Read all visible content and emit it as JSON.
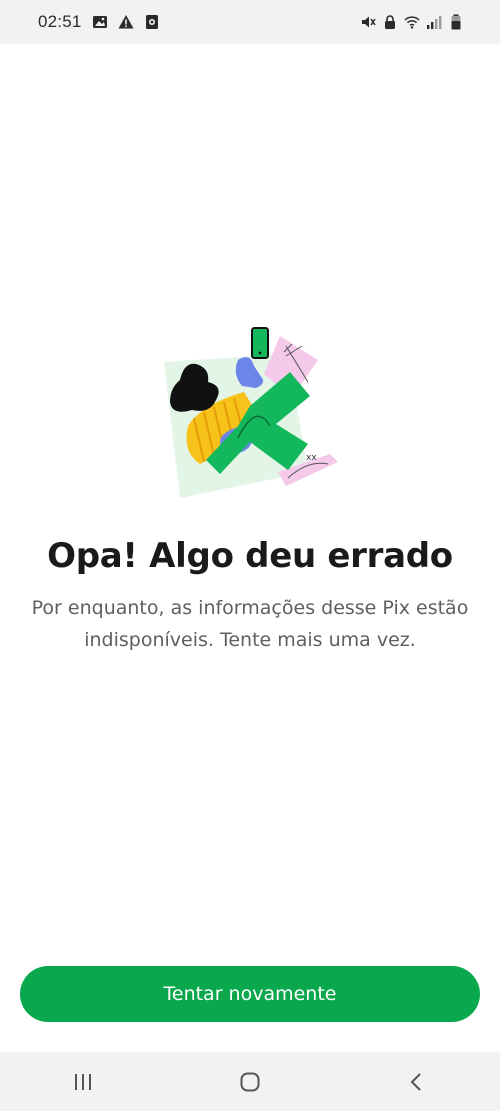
{
  "status_bar": {
    "time": "02:51",
    "left_icons": [
      "image-icon",
      "warning-icon",
      "sim-app-icon"
    ],
    "right_icons": [
      "mute-icon",
      "lock-icon",
      "wifi-icon",
      "signal-icon",
      "battery-icon"
    ]
  },
  "error": {
    "illustration": "error-illustration",
    "title": "Opa! Algo deu errado",
    "message": "Por enquanto, as informações desse Pix estão indisponíveis. Tente mais uma vez."
  },
  "actions": {
    "retry_label": "Tentar novamente"
  },
  "nav_bar": {
    "buttons": [
      "recent-apps-icon",
      "home-icon",
      "back-icon"
    ]
  },
  "colors": {
    "accent": "#0aa84d",
    "text_primary": "#1a1a1a",
    "text_secondary": "#5f5f5f",
    "system_bar": "#f2f2f2"
  }
}
